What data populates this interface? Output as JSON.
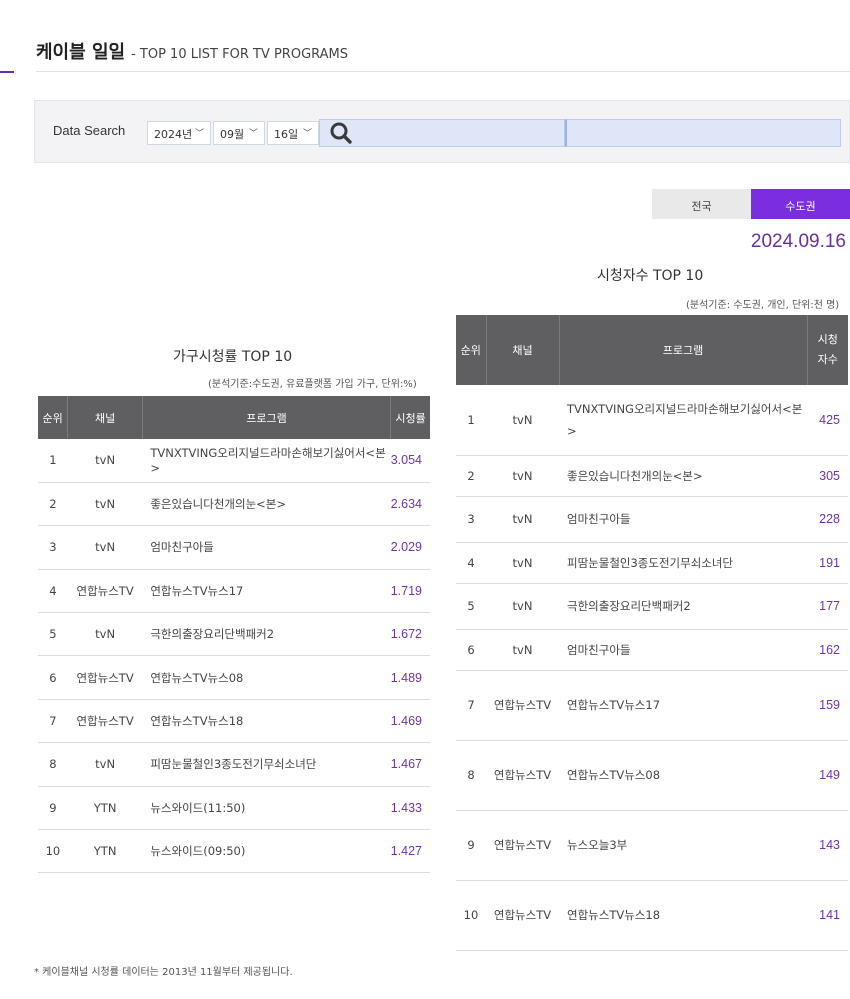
{
  "header": {
    "title": "케이블 일일",
    "subtitle": "- TOP 10 LIST FOR TV PROGRAMS"
  },
  "search": {
    "label": "Data Search",
    "year": "2024년",
    "month": "09월",
    "day": "16일"
  },
  "region_tabs": [
    {
      "label": "전국",
      "active": false
    },
    {
      "label": "수도권",
      "active": true
    }
  ],
  "date_display": "2024.09.16",
  "household": {
    "title": "가구시청률 TOP 10",
    "note": "(분석기준:수도권, 유료플랫폼 가입 가구, 단위:%)",
    "headers": [
      "순위",
      "채널",
      "프로그램",
      "시청률"
    ],
    "rows": [
      {
        "rank": "1",
        "channel": "tvN",
        "program": "TVNXTVING오리지널드라마손해보기싫어서<본>",
        "value": "3.054"
      },
      {
        "rank": "2",
        "channel": "tvN",
        "program": "좋은있습니다천개의눈<본>",
        "value": "2.634"
      },
      {
        "rank": "3",
        "channel": "tvN",
        "program": "엄마친구아들",
        "value": "2.029"
      },
      {
        "rank": "4",
        "channel": "연합뉴스TV",
        "program": "연합뉴스TV뉴스17",
        "value": "1.719"
      },
      {
        "rank": "5",
        "channel": "tvN",
        "program": "극한의출장요리단백패커2",
        "value": "1.672"
      },
      {
        "rank": "6",
        "channel": "연합뉴스TV",
        "program": "연합뉴스TV뉴스08",
        "value": "1.489"
      },
      {
        "rank": "7",
        "channel": "연합뉴스TV",
        "program": "연합뉴스TV뉴스18",
        "value": "1.469"
      },
      {
        "rank": "8",
        "channel": "tvN",
        "program": "피땀눈물철인3종도전기무쇠소녀단",
        "value": "1.467"
      },
      {
        "rank": "9",
        "channel": "YTN",
        "program": "뉴스와이드(11:50)",
        "value": "1.433"
      },
      {
        "rank": "10",
        "channel": "YTN",
        "program": "뉴스와이드(09:50)",
        "value": "1.427"
      }
    ]
  },
  "viewers": {
    "title": "시청자수 TOP 10",
    "note": "(분석기준: 수도권, 개인, 단위:천 명)",
    "headers": [
      "순위",
      "채널",
      "프로그램",
      "시청자수"
    ],
    "rows": [
      {
        "rank": "1",
        "channel": "tvN",
        "program": "TVNXTVING오리지널드라마손해보기싫어서<본>",
        "value": "425"
      },
      {
        "rank": "2",
        "channel": "tvN",
        "program": "좋은있습니다천개의눈<본>",
        "value": "305"
      },
      {
        "rank": "3",
        "channel": "tvN",
        "program": "엄마친구아들",
        "value": "228"
      },
      {
        "rank": "4",
        "channel": "tvN",
        "program": "피땀눈물철인3종도전기무쇠소녀단",
        "value": "191"
      },
      {
        "rank": "5",
        "channel": "tvN",
        "program": "극한의출장요리단백패커2",
        "value": "177"
      },
      {
        "rank": "6",
        "channel": "tvN",
        "program": "엄마친구아들",
        "value": "162"
      },
      {
        "rank": "7",
        "channel": "연합뉴스TV",
        "program": "연합뉴스TV뉴스17",
        "value": "159"
      },
      {
        "rank": "8",
        "channel": "연합뉴스TV",
        "program": "연합뉴스TV뉴스08",
        "value": "149"
      },
      {
        "rank": "9",
        "channel": "연합뉴스TV",
        "program": "뉴스오늘3부",
        "value": "143"
      },
      {
        "rank": "10",
        "channel": "연합뉴스TV",
        "program": "연합뉴스TV뉴스18",
        "value": "141"
      }
    ]
  },
  "footnote": "* 케이블채널 시청률 데이터는 2013년 11월부터 제공됩니다.",
  "colors": {
    "accent": "#7a2ee0",
    "value_text": "#6d35a6",
    "header_bg": "#5f5f62"
  }
}
